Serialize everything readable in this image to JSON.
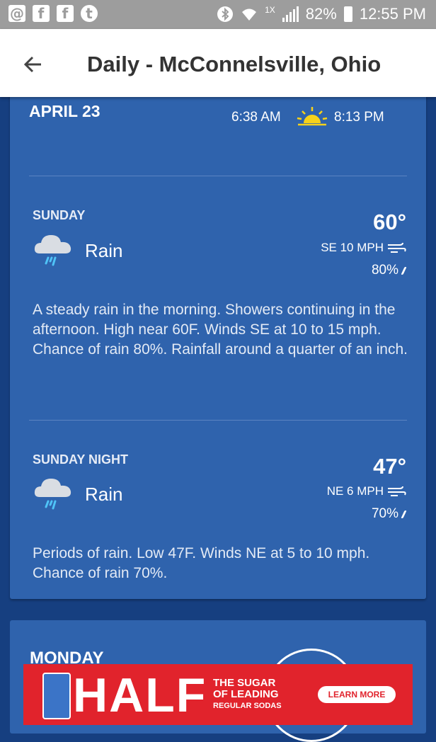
{
  "status_bar": {
    "left_icons": [
      "at-icon",
      "facebook-icon",
      "facebook-icon",
      "tumblr-icon"
    ],
    "right_icons": [
      "bluetooth-icon",
      "wifi-icon",
      "signal-icon",
      "battery-icon"
    ],
    "network_label": "1X",
    "battery": "82%",
    "time": "12:55 PM"
  },
  "app_bar": {
    "back_icon": "arrow-left-icon",
    "title": "Daily - McConnelsville, Ohio"
  },
  "day_card": {
    "date": "APRIL 23",
    "sunrise": "6:38 AM",
    "sunset": "8:13 PM",
    "sun_icon": "sunrise-sunset-icon",
    "periods": [
      {
        "name": "SUNDAY",
        "temp": "60°",
        "icon": "rain-cloud-icon",
        "condition": "Rain",
        "wind": "SE 10 MPH",
        "precip": "80%",
        "description": "A steady rain in the morning. Showers continuing in the afternoon. High near 60F. Winds SE at 10 to 15 mph. Chance of rain 80%. Rainfall around a quarter of an inch."
      },
      {
        "name": "SUNDAY NIGHT",
        "temp": "47°",
        "icon": "rain-cloud-icon",
        "condition": "Rain",
        "wind": "NE 6 MPH",
        "precip": "70%",
        "description": "Periods of rain. Low 47F. Winds NE at 5 to 10 mph. Chance of rain 70%."
      }
    ]
  },
  "next_card": {
    "title": "MONDAY"
  },
  "ad": {
    "headline": "HALF",
    "tagline": [
      "THE SUGAR",
      "OF LEADING",
      "REGULAR SODAS"
    ],
    "button": "LEARN MORE"
  },
  "colors": {
    "status_bar": "#9d9d9d",
    "background": "#163f80",
    "card": "#2f63ad",
    "ad": "#e1232c",
    "sun": "#f7d21a"
  }
}
